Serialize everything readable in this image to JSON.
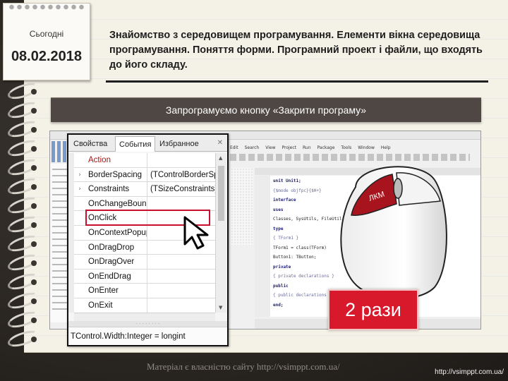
{
  "date_card": {
    "today_label": "Сьогодні",
    "date": "08.02.2018"
  },
  "header": {
    "title": "Знайомство з середовищем програмування. Елементи вікна середовища програмування. Поняття форми. Програмний проект і файли, що входять до його складу."
  },
  "banner": {
    "text": "Запрограмуємо кнопку «Закрити програму»"
  },
  "inspector": {
    "tabs": [
      "Свойства",
      "События",
      "Избранное"
    ],
    "rows": [
      {
        "name": "Action",
        "value": "",
        "arrow": "",
        "highlight_name": true
      },
      {
        "name": "BorderSpacing",
        "value": "(TControlBorderSp",
        "arrow": "›"
      },
      {
        "name": "Constraints",
        "value": "(TSizeConstraints)",
        "arrow": "›"
      },
      {
        "name": "OnChangeBounds",
        "value": "",
        "arrow": ""
      },
      {
        "name": "OnClick",
        "value": "",
        "arrow": ""
      },
      {
        "name": "OnContextPopup",
        "value": "",
        "arrow": ""
      },
      {
        "name": "OnDragDrop",
        "value": "",
        "arrow": ""
      },
      {
        "name": "OnDragOver",
        "value": "",
        "arrow": ""
      },
      {
        "name": "OnEndDrag",
        "value": "",
        "arrow": ""
      },
      {
        "name": "OnEnter",
        "value": "",
        "arrow": ""
      },
      {
        "name": "OnExit",
        "value": "",
        "arrow": ""
      }
    ],
    "hint": "TControl.Width:Integer = longint",
    "selected_event": "OnClick"
  },
  "ide": {
    "menu": [
      "Edit",
      "Search",
      "View",
      "Project",
      "Run",
      "Package",
      "Tools",
      "Window",
      "Help"
    ],
    "code": [
      {
        "text": "unit Unit1;",
        "cls": "kw"
      },
      {
        "text": "{$mode objfpc}{$H+}",
        "cls": "cm"
      },
      {
        "text": "interface",
        "cls": "kw"
      },
      {
        "text": "uses",
        "cls": "kw"
      },
      {
        "text": "  Classes, SysUtils, FileUtil, Forms, Controls, Graphics, Dialogs;",
        "cls": ""
      },
      {
        "text": "type",
        "cls": "kw"
      },
      {
        "text": "  { TForm1 }",
        "cls": "cm"
      },
      {
        "text": "  TForm1 = class(TForm)",
        "cls": ""
      },
      {
        "text": "    Button1: TButton;",
        "cls": ""
      },
      {
        "text": "  private",
        "cls": "kw"
      },
      {
        "text": "    { private declarations }",
        "cls": "cm"
      },
      {
        "text": "  public",
        "cls": "kw"
      },
      {
        "text": "    { public declarations }",
        "cls": "cm"
      },
      {
        "text": "  end;",
        "cls": "kw"
      }
    ]
  },
  "badge": {
    "text": "2 рази"
  },
  "mouse": {
    "logo": "ЛКМ"
  },
  "footer": {
    "watermark": "Матеріал є власністю сайту http://vsimppt.com.ua/",
    "credit": "http://vsimppt.com.ua/"
  },
  "colors": {
    "accent": "#c8102e",
    "banner_bg": "#4e4743",
    "paper": "#f4f1e6"
  }
}
